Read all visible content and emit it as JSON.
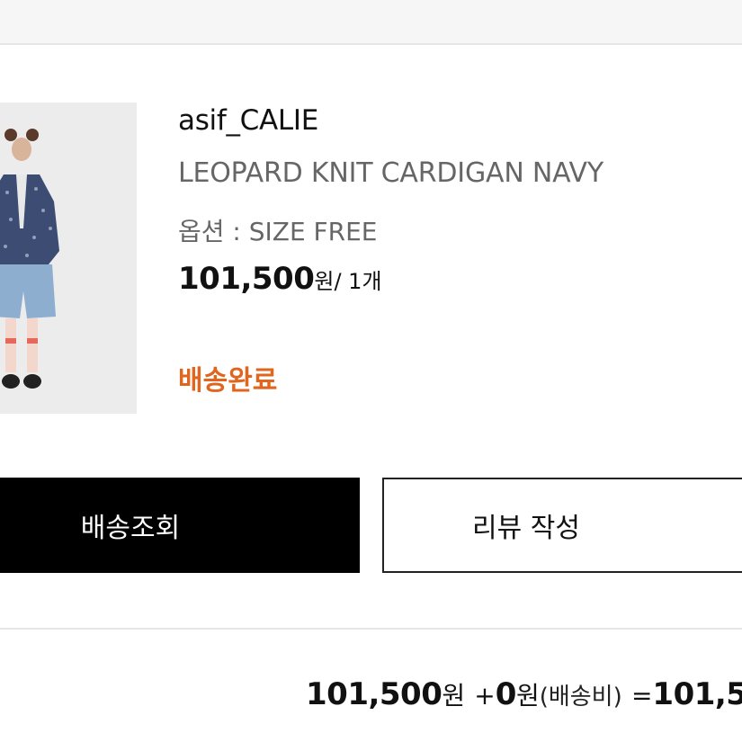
{
  "order_item": {
    "brand": "asif_CALIE",
    "product_name": "LEOPARD KNIT CARDIGAN NAVY",
    "option": "옵션 : SIZE FREE",
    "price": "101,500",
    "price_unit": "원",
    "quantity": "/ 1개",
    "status": "배송완료",
    "image_icon": "product-photo"
  },
  "actions": {
    "track_label": "배송조회",
    "review_label": "리뷰 작성"
  },
  "summary": {
    "product_total": "101,500",
    "product_total_unit": "원",
    "plus": "+",
    "shipping_fee": "0",
    "shipping_fee_unit": "원",
    "shipping_note": "(배송비)",
    "equals": "=",
    "grand_total": "101,5"
  },
  "colors": {
    "status": "#e0651e",
    "primary_button": "#000000"
  }
}
